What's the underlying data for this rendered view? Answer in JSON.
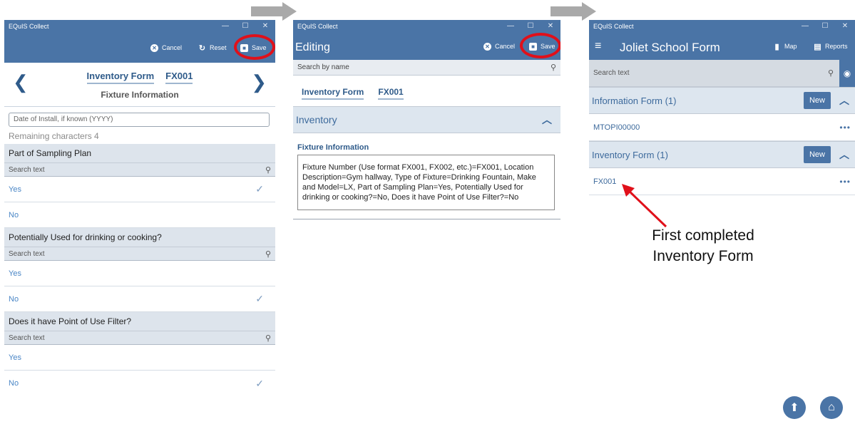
{
  "screens": [
    {
      "window_title": "EQuIS Collect",
      "actions": {
        "cancel": "Cancel",
        "reset": "Reset",
        "save": "Save"
      },
      "tabs": [
        "Inventory Form",
        "FX001"
      ],
      "subtitle": "Fixture Information",
      "date_field_placeholder": "Date of Install, if known (YYYY)",
      "remaining": "Remaining characters 4",
      "questions": [
        {
          "label": "Part of Sampling Plan",
          "search": "Search text",
          "options": [
            {
              "label": "Yes",
              "checked": true
            },
            {
              "label": "No",
              "checked": false
            }
          ]
        },
        {
          "label": "Potentially Used for drinking or cooking?",
          "search": "Search text",
          "options": [
            {
              "label": "Yes",
              "checked": false
            },
            {
              "label": "No",
              "checked": true
            }
          ]
        },
        {
          "label": "Does it have Point of Use Filter?",
          "search": "Search text",
          "options": [
            {
              "label": "Yes",
              "checked": false
            },
            {
              "label": "No",
              "checked": true
            }
          ]
        }
      ]
    },
    {
      "window_title": "EQuIS Collect",
      "title": "Editing",
      "actions": {
        "cancel": "Cancel",
        "save": "Save"
      },
      "search_placeholder": "Search by name",
      "tabs": [
        "Inventory Form",
        "FX001"
      ],
      "section": "Inventory",
      "fixture_label": "Fixture Information",
      "summary": "Fixture Number (Use format FX001, FX002, etc.)=FX001, Location Description=Gym hallway, Type of Fixture=Drinking Fountain, Make and Model=LX, Part of Sampling Plan=Yes, Potentially Used for drinking or cooking?=No, Does it have Point of Use Filter?=No"
    },
    {
      "window_title": "EQuIS Collect",
      "title": "Joliet School Form",
      "actions": {
        "map": "Map",
        "reports": "Reports"
      },
      "search_placeholder": "Search text",
      "groups": [
        {
          "label": "Information Form (1)",
          "new": "New",
          "records": [
            "MTOPI00000"
          ]
        },
        {
          "label": "Inventory Form (1)",
          "new": "New",
          "records": [
            "FX001"
          ]
        }
      ]
    }
  ],
  "annotation": {
    "line1": "First completed",
    "line2": "Inventory Form"
  },
  "colors": {
    "brand": "#4a74a6",
    "highlight": "#e0101a",
    "link": "#2f5b8a"
  }
}
